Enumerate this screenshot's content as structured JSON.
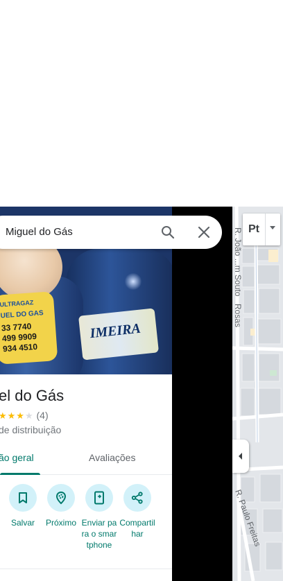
{
  "search": {
    "query": "Miguel do Gás"
  },
  "place": {
    "name": "el do Gás",
    "rating_count": "(4)",
    "rating_value": 4,
    "category": "de distribuição",
    "photo_text": {
      "brand": "ULTRAGAZ",
      "shop": "UEL DO GAS",
      "phone1": "33 7740",
      "phone2": "499 9909",
      "phone3": "934 4510",
      "cylinder_label": "IMEIRA"
    }
  },
  "tabs": [
    {
      "label": "ão geral",
      "active": true
    },
    {
      "label": "Avaliações",
      "active": false
    }
  ],
  "actions": [
    {
      "label": "Salvar",
      "icon": "bookmark-icon"
    },
    {
      "label": "Próximo",
      "icon": "nearby-icon"
    },
    {
      "label": "Enviar para o smartphone",
      "icon": "send-to-phone-icon"
    },
    {
      "label": "Compartilhar",
      "icon": "share-icon"
    }
  ],
  "map": {
    "layer_label": "Pt",
    "streets": [
      "R. João ...m Souto",
      "Rosas",
      "R. Paulo Freitas"
    ]
  },
  "colors": {
    "accent": "#00796b",
    "action_bg": "#d2f1f9",
    "star": "#fbbc04"
  }
}
